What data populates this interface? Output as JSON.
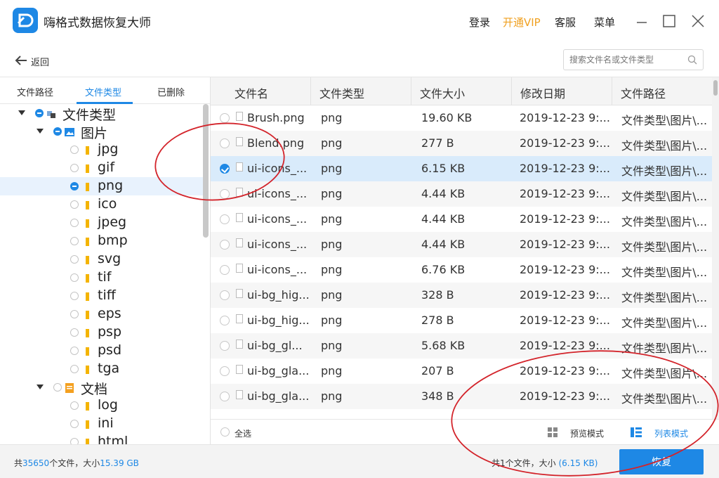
{
  "app": {
    "title": "嗨格式数据恢复大师",
    "brand_color": "#1e88e5",
    "vip_color": "#f0a020"
  },
  "titlebar": {
    "login": "登录",
    "vip": "开通VIP",
    "service": "客服",
    "menu": "菜单",
    "icons": [
      "minimize-icon",
      "maximize-icon",
      "close-icon"
    ]
  },
  "toolbar": {
    "back_label": "返回",
    "search_placeholder": "搜索文件名或文件类型"
  },
  "left_tabs": [
    "文件路径",
    "文件类型",
    "已删除"
  ],
  "left_active_tab": 1,
  "tree": [
    {
      "label": "文件类型",
      "level": 0,
      "expand": true,
      "state": "partial",
      "icon": "category-icon"
    },
    {
      "label": "图片",
      "level": 1,
      "expand": true,
      "state": "partial",
      "icon": "image-folder-icon"
    },
    {
      "label": "jpg",
      "level": 2,
      "state": "none",
      "icon": "folder-icon"
    },
    {
      "label": "gif",
      "level": 2,
      "state": "none",
      "icon": "folder-icon"
    },
    {
      "label": "png",
      "level": 2,
      "state": "partial",
      "icon": "folder-icon",
      "selected": true
    },
    {
      "label": "ico",
      "level": 2,
      "state": "none",
      "icon": "folder-icon"
    },
    {
      "label": "jpeg",
      "level": 2,
      "state": "none",
      "icon": "folder-icon"
    },
    {
      "label": "bmp",
      "level": 2,
      "state": "none",
      "icon": "folder-icon"
    },
    {
      "label": "svg",
      "level": 2,
      "state": "none",
      "icon": "folder-icon"
    },
    {
      "label": "tif",
      "level": 2,
      "state": "none",
      "icon": "folder-icon"
    },
    {
      "label": "tiff",
      "level": 2,
      "state": "none",
      "icon": "folder-icon"
    },
    {
      "label": "eps",
      "level": 2,
      "state": "none",
      "icon": "folder-icon"
    },
    {
      "label": "psp",
      "level": 2,
      "state": "none",
      "icon": "folder-icon"
    },
    {
      "label": "psd",
      "level": 2,
      "state": "none",
      "icon": "folder-icon"
    },
    {
      "label": "tga",
      "level": 2,
      "state": "none",
      "icon": "folder-icon"
    },
    {
      "label": "文档",
      "level": 1,
      "expand": true,
      "state": "none",
      "icon": "document-folder-icon"
    },
    {
      "label": "log",
      "level": 2,
      "state": "none",
      "icon": "folder-icon"
    },
    {
      "label": "ini",
      "level": 2,
      "state": "none",
      "icon": "folder-icon"
    },
    {
      "label": "html",
      "level": 2,
      "state": "none",
      "icon": "folder-icon"
    }
  ],
  "table": {
    "columns": [
      "文件名",
      "文件类型",
      "文件大小",
      "修改日期",
      "文件路径"
    ],
    "rows": [
      {
        "name": "Brush.png",
        "type": "png",
        "size": "19.60 KB",
        "date": "2019-12-23 9:...",
        "path": "文件类型\\图片\\...",
        "checked": false
      },
      {
        "name": "Blend.png",
        "type": "png",
        "size": "277 B",
        "date": "2019-12-23 9:...",
        "path": "文件类型\\图片\\...",
        "checked": false
      },
      {
        "name": "ui-icons_...",
        "type": "png",
        "size": "6.15 KB",
        "date": "2019-12-23 9:...",
        "path": "文件类型\\图片\\...",
        "checked": true
      },
      {
        "name": "ui-icons_...",
        "type": "png",
        "size": "4.44 KB",
        "date": "2019-12-23 9:...",
        "path": "文件类型\\图片\\...",
        "checked": false
      },
      {
        "name": "ui-icons_...",
        "type": "png",
        "size": "4.44 KB",
        "date": "2019-12-23 9:...",
        "path": "文件类型\\图片\\...",
        "checked": false
      },
      {
        "name": "ui-icons_...",
        "type": "png",
        "size": "4.44 KB",
        "date": "2019-12-23 9:...",
        "path": "文件类型\\图片\\...",
        "checked": false
      },
      {
        "name": "ui-icons_...",
        "type": "png",
        "size": "6.76 KB",
        "date": "2019-12-23 9:...",
        "path": "文件类型\\图片\\...",
        "checked": false
      },
      {
        "name": "ui-bg_hig...",
        "type": "png",
        "size": "328 B",
        "date": "2019-12-23 9:...",
        "path": "文件类型\\图片\\...",
        "checked": false
      },
      {
        "name": "ui-bg_hig...",
        "type": "png",
        "size": "278 B",
        "date": "2019-12-23 9:...",
        "path": "文件类型\\图片\\...",
        "checked": false
      },
      {
        "name": "ui-bg_gl...",
        "type": "png",
        "size": "5.68 KB",
        "date": "2019-12-23 9:...",
        "path": "文件类型\\图片\\...",
        "checked": false
      },
      {
        "name": "ui-bg_gla...",
        "type": "png",
        "size": "207 B",
        "date": "2019-12-23 9:...",
        "path": "文件类型\\图片\\...",
        "checked": false
      },
      {
        "name": "ui-bg_gla...",
        "type": "png",
        "size": "348 B",
        "date": "2019-12-23 9:...",
        "path": "文件类型\\图片\\...",
        "checked": false
      }
    ]
  },
  "table_footer": {
    "select_all": "全选",
    "preview_mode": "预览模式",
    "list_mode": "列表模式"
  },
  "status": {
    "total_prefix": "共",
    "total_count": "35650",
    "total_mid": "个文件，大小",
    "total_size": "15.39 GB",
    "selected_text": "共1个文件，大小",
    "selected_size": "(6.15 KB)",
    "recover_label": "恢复"
  }
}
